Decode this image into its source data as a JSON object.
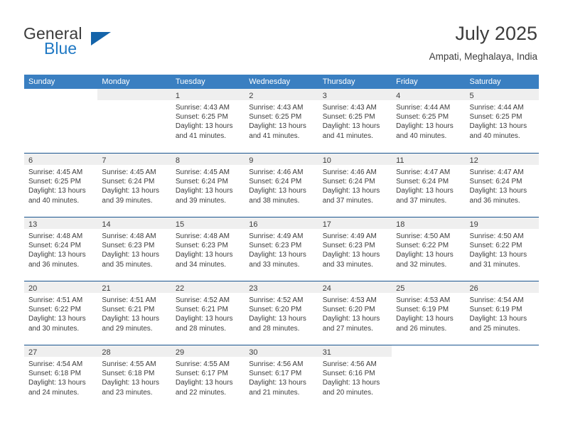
{
  "brand": {
    "name_top": "General",
    "name_bottom": "Blue",
    "flag_icon": "triangle-flag-icon",
    "accent_color": "#1464aa",
    "blue_text_color": "#2079c4"
  },
  "header": {
    "title": "July 2025",
    "subtitle": "Ampati, Meghalaya, India"
  },
  "calendar": {
    "header_bg": "#3a7fc1",
    "day_band_bg": "#efefef",
    "row_divider_color": "#19558f",
    "weekdays": [
      "Sunday",
      "Monday",
      "Tuesday",
      "Wednesday",
      "Thursday",
      "Friday",
      "Saturday"
    ],
    "weeks": [
      [
        {
          "day": "",
          "sunrise": "",
          "sunset": "",
          "daylight": "",
          "blank": true
        },
        {
          "day": "",
          "sunrise": "",
          "sunset": "",
          "daylight": "",
          "empty": true
        },
        {
          "day": "1",
          "sunrise": "Sunrise: 4:43 AM",
          "sunset": "Sunset: 6:25 PM",
          "daylight": "Daylight: 13 hours and 41 minutes."
        },
        {
          "day": "2",
          "sunrise": "Sunrise: 4:43 AM",
          "sunset": "Sunset: 6:25 PM",
          "daylight": "Daylight: 13 hours and 41 minutes."
        },
        {
          "day": "3",
          "sunrise": "Sunrise: 4:43 AM",
          "sunset": "Sunset: 6:25 PM",
          "daylight": "Daylight: 13 hours and 41 minutes."
        },
        {
          "day": "4",
          "sunrise": "Sunrise: 4:44 AM",
          "sunset": "Sunset: 6:25 PM",
          "daylight": "Daylight: 13 hours and 40 minutes."
        },
        {
          "day": "5",
          "sunrise": "Sunrise: 4:44 AM",
          "sunset": "Sunset: 6:25 PM",
          "daylight": "Daylight: 13 hours and 40 minutes."
        }
      ],
      [
        {
          "day": "6",
          "sunrise": "Sunrise: 4:45 AM",
          "sunset": "Sunset: 6:25 PM",
          "daylight": "Daylight: 13 hours and 40 minutes."
        },
        {
          "day": "7",
          "sunrise": "Sunrise: 4:45 AM",
          "sunset": "Sunset: 6:24 PM",
          "daylight": "Daylight: 13 hours and 39 minutes."
        },
        {
          "day": "8",
          "sunrise": "Sunrise: 4:45 AM",
          "sunset": "Sunset: 6:24 PM",
          "daylight": "Daylight: 13 hours and 39 minutes."
        },
        {
          "day": "9",
          "sunrise": "Sunrise: 4:46 AM",
          "sunset": "Sunset: 6:24 PM",
          "daylight": "Daylight: 13 hours and 38 minutes."
        },
        {
          "day": "10",
          "sunrise": "Sunrise: 4:46 AM",
          "sunset": "Sunset: 6:24 PM",
          "daylight": "Daylight: 13 hours and 37 minutes."
        },
        {
          "day": "11",
          "sunrise": "Sunrise: 4:47 AM",
          "sunset": "Sunset: 6:24 PM",
          "daylight": "Daylight: 13 hours and 37 minutes."
        },
        {
          "day": "12",
          "sunrise": "Sunrise: 4:47 AM",
          "sunset": "Sunset: 6:24 PM",
          "daylight": "Daylight: 13 hours and 36 minutes."
        }
      ],
      [
        {
          "day": "13",
          "sunrise": "Sunrise: 4:48 AM",
          "sunset": "Sunset: 6:24 PM",
          "daylight": "Daylight: 13 hours and 36 minutes."
        },
        {
          "day": "14",
          "sunrise": "Sunrise: 4:48 AM",
          "sunset": "Sunset: 6:23 PM",
          "daylight": "Daylight: 13 hours and 35 minutes."
        },
        {
          "day": "15",
          "sunrise": "Sunrise: 4:48 AM",
          "sunset": "Sunset: 6:23 PM",
          "daylight": "Daylight: 13 hours and 34 minutes."
        },
        {
          "day": "16",
          "sunrise": "Sunrise: 4:49 AM",
          "sunset": "Sunset: 6:23 PM",
          "daylight": "Daylight: 13 hours and 33 minutes."
        },
        {
          "day": "17",
          "sunrise": "Sunrise: 4:49 AM",
          "sunset": "Sunset: 6:23 PM",
          "daylight": "Daylight: 13 hours and 33 minutes."
        },
        {
          "day": "18",
          "sunrise": "Sunrise: 4:50 AM",
          "sunset": "Sunset: 6:22 PM",
          "daylight": "Daylight: 13 hours and 32 minutes."
        },
        {
          "day": "19",
          "sunrise": "Sunrise: 4:50 AM",
          "sunset": "Sunset: 6:22 PM",
          "daylight": "Daylight: 13 hours and 31 minutes."
        }
      ],
      [
        {
          "day": "20",
          "sunrise": "Sunrise: 4:51 AM",
          "sunset": "Sunset: 6:22 PM",
          "daylight": "Daylight: 13 hours and 30 minutes."
        },
        {
          "day": "21",
          "sunrise": "Sunrise: 4:51 AM",
          "sunset": "Sunset: 6:21 PM",
          "daylight": "Daylight: 13 hours and 29 minutes."
        },
        {
          "day": "22",
          "sunrise": "Sunrise: 4:52 AM",
          "sunset": "Sunset: 6:21 PM",
          "daylight": "Daylight: 13 hours and 28 minutes."
        },
        {
          "day": "23",
          "sunrise": "Sunrise: 4:52 AM",
          "sunset": "Sunset: 6:20 PM",
          "daylight": "Daylight: 13 hours and 28 minutes."
        },
        {
          "day": "24",
          "sunrise": "Sunrise: 4:53 AM",
          "sunset": "Sunset: 6:20 PM",
          "daylight": "Daylight: 13 hours and 27 minutes."
        },
        {
          "day": "25",
          "sunrise": "Sunrise: 4:53 AM",
          "sunset": "Sunset: 6:19 PM",
          "daylight": "Daylight: 13 hours and 26 minutes."
        },
        {
          "day": "26",
          "sunrise": "Sunrise: 4:54 AM",
          "sunset": "Sunset: 6:19 PM",
          "daylight": "Daylight: 13 hours and 25 minutes."
        }
      ],
      [
        {
          "day": "27",
          "sunrise": "Sunrise: 4:54 AM",
          "sunset": "Sunset: 6:18 PM",
          "daylight": "Daylight: 13 hours and 24 minutes."
        },
        {
          "day": "28",
          "sunrise": "Sunrise: 4:55 AM",
          "sunset": "Sunset: 6:18 PM",
          "daylight": "Daylight: 13 hours and 23 minutes."
        },
        {
          "day": "29",
          "sunrise": "Sunrise: 4:55 AM",
          "sunset": "Sunset: 6:17 PM",
          "daylight": "Daylight: 13 hours and 22 minutes."
        },
        {
          "day": "30",
          "sunrise": "Sunrise: 4:56 AM",
          "sunset": "Sunset: 6:17 PM",
          "daylight": "Daylight: 13 hours and 21 minutes."
        },
        {
          "day": "31",
          "sunrise": "Sunrise: 4:56 AM",
          "sunset": "Sunset: 6:16 PM",
          "daylight": "Daylight: 13 hours and 20 minutes."
        },
        {
          "day": "",
          "sunrise": "",
          "sunset": "",
          "daylight": "",
          "blank": true
        },
        {
          "day": "",
          "sunrise": "",
          "sunset": "",
          "daylight": "",
          "blank": true
        }
      ]
    ]
  }
}
